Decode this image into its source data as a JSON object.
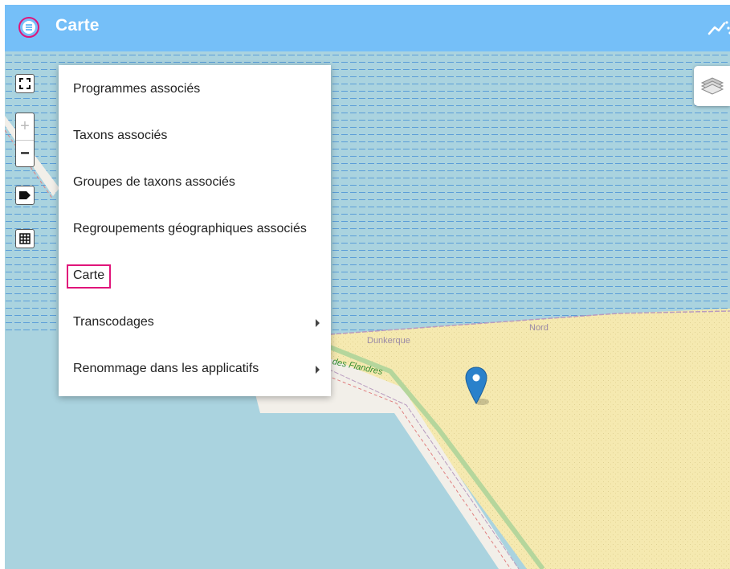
{
  "header": {
    "title": "Carte",
    "menu_icon": "menu-icon",
    "right_icon": "trending-icon"
  },
  "colors": {
    "header": "#75bff8",
    "highlight": "#e0157a",
    "sea": "#aad3df",
    "land": "#f5e9b0"
  },
  "map": {
    "labels": {
      "city": "Dunkerque",
      "region": "Nord",
      "road": "des Flandres"
    },
    "controls": {
      "fullscreen_icon": "fullscreen-icon",
      "zoom_in": "+",
      "zoom_out": "−",
      "tag_icon": "tag-icon",
      "grid_icon": "grid-icon",
      "layers_icon": "layers-icon",
      "marker_icon": "location-pin-icon"
    }
  },
  "menu": {
    "items": [
      {
        "label": "Programmes associés",
        "submenu": false
      },
      {
        "label": "Taxons associés",
        "submenu": false
      },
      {
        "label": "Groupes de taxons associés",
        "submenu": false
      },
      {
        "label": "Regroupements géographiques associés",
        "submenu": false
      },
      {
        "label": "Carte",
        "submenu": false,
        "active": true
      },
      {
        "label": "Transcodages",
        "submenu": true
      },
      {
        "label": "Renommage dans les applicatifs",
        "submenu": true
      }
    ]
  }
}
